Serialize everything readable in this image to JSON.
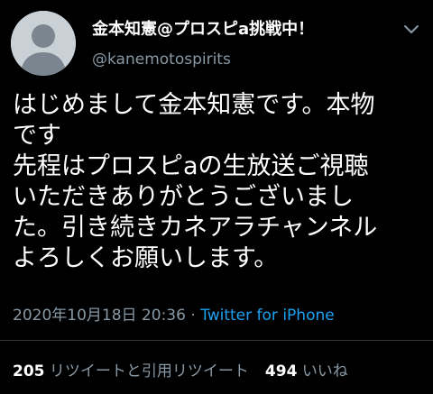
{
  "user": {
    "display_name": "金本知憲@プロスピa挑戦中！",
    "handle": "@kanemotospirits",
    "avatar_icon": "default-avatar-icon"
  },
  "menu_icon": "chevron-down-icon",
  "tweet": {
    "lines": [
      "はじめまして金本知憲です。本物",
      "です",
      "先程はプロスピaの生放送ご視聴",
      "いただきありがとうございまし",
      "た。引き続きカネアラチャンネル",
      "よろしくお願いします。"
    ]
  },
  "meta": {
    "timestamp": "2020年10月18日 20:36",
    "separator": " · ",
    "source": "Twitter for iPhone"
  },
  "stats": {
    "retweets_count": "205",
    "retweets_label": "リツイートと引用リツイート",
    "likes_count": "494",
    "likes_label": "いいね"
  },
  "colors": {
    "background": "#000000",
    "text": "#ffffff",
    "secondary": "#8899a6",
    "link": "#1da1f2",
    "divider": "#2f3336"
  }
}
